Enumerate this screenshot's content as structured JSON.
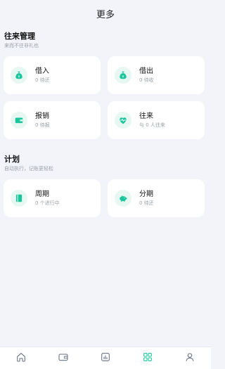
{
  "header": {
    "title": "更多"
  },
  "sections": [
    {
      "title": "往来管理",
      "subtitle": "来而不往非礼也",
      "cards": [
        {
          "title": "借入",
          "sub": "0 待还",
          "icon": "money-bag-icon"
        },
        {
          "title": "借出",
          "sub": "0 待收",
          "icon": "money-bag-icon"
        },
        {
          "title": "报销",
          "sub": "0 待报",
          "icon": "wallet-icon"
        },
        {
          "title": "往来",
          "sub": "与 0 人往来",
          "icon": "heart-pulse-icon"
        }
      ]
    },
    {
      "title": "计划",
      "subtitle": "自动执行，记账更轻松",
      "cards": [
        {
          "title": "周期",
          "sub": "0 个进行中",
          "icon": "notebook-icon"
        },
        {
          "title": "分期",
          "sub": "0 待还",
          "icon": "piggy-bank-icon"
        }
      ]
    }
  ],
  "tabbar": [
    {
      "icon": "home-icon",
      "active": false
    },
    {
      "icon": "wallet-icon",
      "active": false
    },
    {
      "icon": "chart-icon",
      "active": false
    },
    {
      "icon": "grid-icon",
      "active": true
    },
    {
      "icon": "user-icon",
      "active": false
    }
  ],
  "colors": {
    "accent": "#19c59a",
    "accent_bg": "#e7f8f3",
    "page_bg": "#f2f4f9",
    "tab_inactive": "#6b7280"
  }
}
